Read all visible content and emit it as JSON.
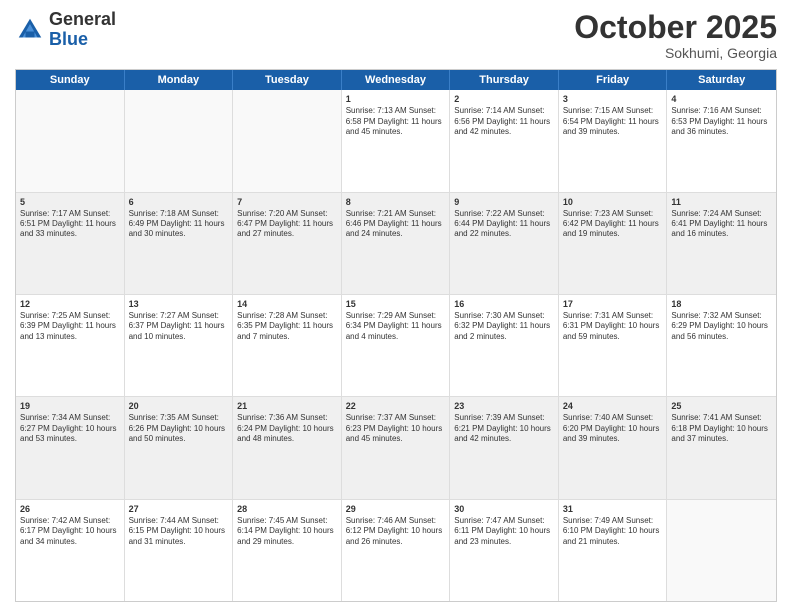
{
  "logo": {
    "general": "General",
    "blue": "Blue"
  },
  "title": "October 2025",
  "subtitle": "Sokhumi, Georgia",
  "days": [
    "Sunday",
    "Monday",
    "Tuesday",
    "Wednesday",
    "Thursday",
    "Friday",
    "Saturday"
  ],
  "rows": [
    [
      {
        "day": "",
        "text": "",
        "empty": true
      },
      {
        "day": "",
        "text": "",
        "empty": true
      },
      {
        "day": "",
        "text": "",
        "empty": true
      },
      {
        "day": "1",
        "text": "Sunrise: 7:13 AM\nSunset: 6:58 PM\nDaylight: 11 hours and 45 minutes."
      },
      {
        "day": "2",
        "text": "Sunrise: 7:14 AM\nSunset: 6:56 PM\nDaylight: 11 hours and 42 minutes."
      },
      {
        "day": "3",
        "text": "Sunrise: 7:15 AM\nSunset: 6:54 PM\nDaylight: 11 hours and 39 minutes."
      },
      {
        "day": "4",
        "text": "Sunrise: 7:16 AM\nSunset: 6:53 PM\nDaylight: 11 hours and 36 minutes."
      }
    ],
    [
      {
        "day": "5",
        "text": "Sunrise: 7:17 AM\nSunset: 6:51 PM\nDaylight: 11 hours and 33 minutes.",
        "shaded": true
      },
      {
        "day": "6",
        "text": "Sunrise: 7:18 AM\nSunset: 6:49 PM\nDaylight: 11 hours and 30 minutes.",
        "shaded": true
      },
      {
        "day": "7",
        "text": "Sunrise: 7:20 AM\nSunset: 6:47 PM\nDaylight: 11 hours and 27 minutes.",
        "shaded": true
      },
      {
        "day": "8",
        "text": "Sunrise: 7:21 AM\nSunset: 6:46 PM\nDaylight: 11 hours and 24 minutes.",
        "shaded": true
      },
      {
        "day": "9",
        "text": "Sunrise: 7:22 AM\nSunset: 6:44 PM\nDaylight: 11 hours and 22 minutes.",
        "shaded": true
      },
      {
        "day": "10",
        "text": "Sunrise: 7:23 AM\nSunset: 6:42 PM\nDaylight: 11 hours and 19 minutes.",
        "shaded": true
      },
      {
        "day": "11",
        "text": "Sunrise: 7:24 AM\nSunset: 6:41 PM\nDaylight: 11 hours and 16 minutes.",
        "shaded": true
      }
    ],
    [
      {
        "day": "12",
        "text": "Sunrise: 7:25 AM\nSunset: 6:39 PM\nDaylight: 11 hours and 13 minutes."
      },
      {
        "day": "13",
        "text": "Sunrise: 7:27 AM\nSunset: 6:37 PM\nDaylight: 11 hours and 10 minutes."
      },
      {
        "day": "14",
        "text": "Sunrise: 7:28 AM\nSunset: 6:35 PM\nDaylight: 11 hours and 7 minutes."
      },
      {
        "day": "15",
        "text": "Sunrise: 7:29 AM\nSunset: 6:34 PM\nDaylight: 11 hours and 4 minutes."
      },
      {
        "day": "16",
        "text": "Sunrise: 7:30 AM\nSunset: 6:32 PM\nDaylight: 11 hours and 2 minutes."
      },
      {
        "day": "17",
        "text": "Sunrise: 7:31 AM\nSunset: 6:31 PM\nDaylight: 10 hours and 59 minutes."
      },
      {
        "day": "18",
        "text": "Sunrise: 7:32 AM\nSunset: 6:29 PM\nDaylight: 10 hours and 56 minutes."
      }
    ],
    [
      {
        "day": "19",
        "text": "Sunrise: 7:34 AM\nSunset: 6:27 PM\nDaylight: 10 hours and 53 minutes.",
        "shaded": true
      },
      {
        "day": "20",
        "text": "Sunrise: 7:35 AM\nSunset: 6:26 PM\nDaylight: 10 hours and 50 minutes.",
        "shaded": true
      },
      {
        "day": "21",
        "text": "Sunrise: 7:36 AM\nSunset: 6:24 PM\nDaylight: 10 hours and 48 minutes.",
        "shaded": true
      },
      {
        "day": "22",
        "text": "Sunrise: 7:37 AM\nSunset: 6:23 PM\nDaylight: 10 hours and 45 minutes.",
        "shaded": true
      },
      {
        "day": "23",
        "text": "Sunrise: 7:39 AM\nSunset: 6:21 PM\nDaylight: 10 hours and 42 minutes.",
        "shaded": true
      },
      {
        "day": "24",
        "text": "Sunrise: 7:40 AM\nSunset: 6:20 PM\nDaylight: 10 hours and 39 minutes.",
        "shaded": true
      },
      {
        "day": "25",
        "text": "Sunrise: 7:41 AM\nSunset: 6:18 PM\nDaylight: 10 hours and 37 minutes.",
        "shaded": true
      }
    ],
    [
      {
        "day": "26",
        "text": "Sunrise: 7:42 AM\nSunset: 6:17 PM\nDaylight: 10 hours and 34 minutes."
      },
      {
        "day": "27",
        "text": "Sunrise: 7:44 AM\nSunset: 6:15 PM\nDaylight: 10 hours and 31 minutes."
      },
      {
        "day": "28",
        "text": "Sunrise: 7:45 AM\nSunset: 6:14 PM\nDaylight: 10 hours and 29 minutes."
      },
      {
        "day": "29",
        "text": "Sunrise: 7:46 AM\nSunset: 6:12 PM\nDaylight: 10 hours and 26 minutes."
      },
      {
        "day": "30",
        "text": "Sunrise: 7:47 AM\nSunset: 6:11 PM\nDaylight: 10 hours and 23 minutes."
      },
      {
        "day": "31",
        "text": "Sunrise: 7:49 AM\nSunset: 6:10 PM\nDaylight: 10 hours and 21 minutes."
      },
      {
        "day": "",
        "text": "",
        "empty": true
      }
    ]
  ]
}
